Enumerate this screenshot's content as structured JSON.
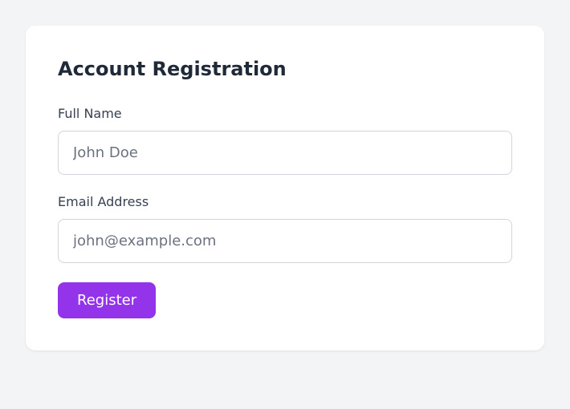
{
  "title": "Account Registration",
  "fields": {
    "fullname": {
      "label": "Full Name",
      "placeholder": "John Doe"
    },
    "email": {
      "label": "Email Address",
      "placeholder": "john@example.com"
    }
  },
  "button": {
    "label": "Register"
  }
}
